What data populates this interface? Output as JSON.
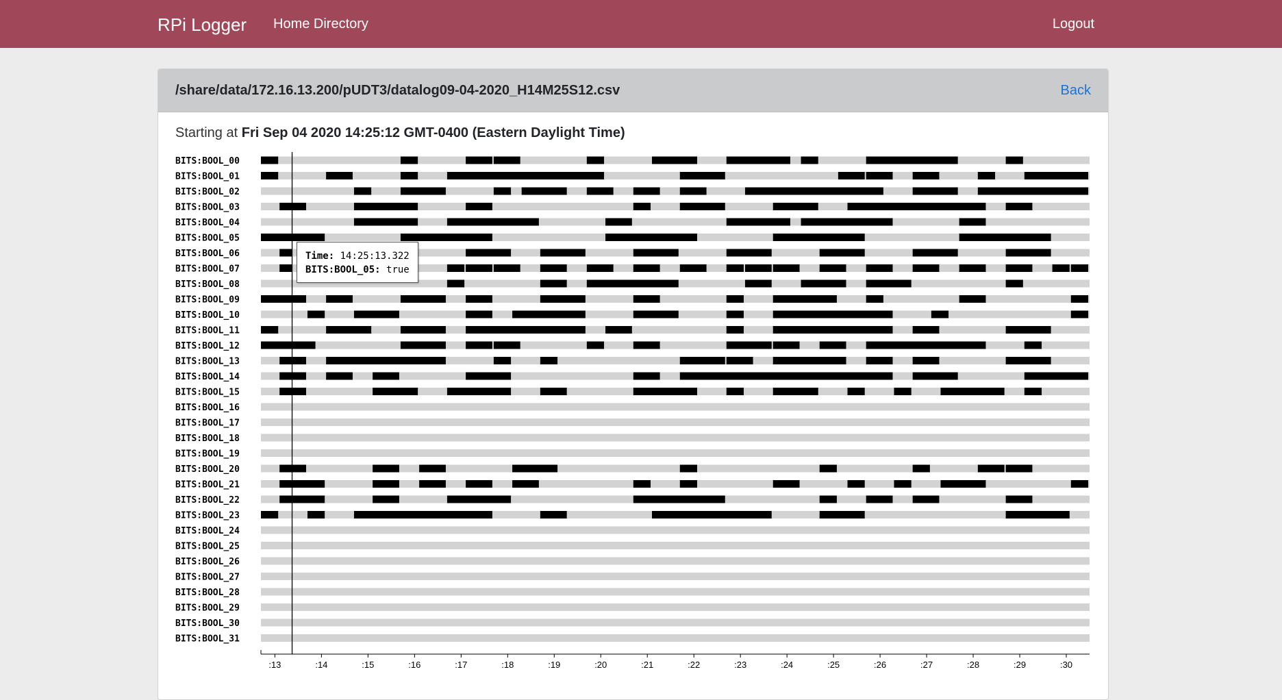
{
  "navbar": {
    "brand": "RPi Logger",
    "home_label": "Home Directory",
    "logout_label": "Logout",
    "color": "#a0485a"
  },
  "header": {
    "file_path": "/share/data/172.16.13.200/pUDT3/datalog09-04-2020_H14M25S12.csv",
    "back_label": "Back"
  },
  "start": {
    "prefix": "Starting at",
    "datetime": "Fri Sep 04 2020 14:25:12 GMT-0400 (Eastern Daylight Time)"
  },
  "tooltip": {
    "time_key": "Time:",
    "time_value": "14:25:13.322",
    "signal_key": "BITS:BOOL_05:",
    "signal_value": "true"
  },
  "chart_data": {
    "type": "timeline",
    "x_unit": "seconds after 14:25:00",
    "xlim": [
      12.7,
      30.5
    ],
    "cursor_x": 13.37,
    "tick_labels": [
      ":13",
      ":14",
      ":15",
      ":16",
      ":17",
      ":18",
      ":19",
      ":20",
      ":21",
      ":22",
      ":23",
      ":24",
      ":25",
      ":26",
      ":27",
      ":28",
      ":29",
      ":30"
    ],
    "tick_values": [
      13,
      14,
      15,
      16,
      17,
      18,
      19,
      20,
      21,
      22,
      23,
      24,
      25,
      26,
      27,
      28,
      29,
      30
    ],
    "colors": {
      "true": "#000000",
      "false": "#d3d3d3"
    },
    "series": [
      {
        "name": "BITS:BOOL_00",
        "true_intervals": [
          [
            12.7,
            13.1
          ],
          [
            15.7,
            16.1
          ],
          [
            17.1,
            17.7
          ],
          [
            17.7,
            18.3
          ],
          [
            19.7,
            20.1
          ],
          [
            21.1,
            22.1
          ],
          [
            22.7,
            24.1
          ],
          [
            24.3,
            24.7
          ],
          [
            25.7,
            27.7
          ],
          [
            28.7,
            29.1
          ]
        ]
      },
      {
        "name": "BITS:BOOL_01",
        "true_intervals": [
          [
            12.7,
            13.1
          ],
          [
            14.1,
            14.7
          ],
          [
            15.7,
            16.1
          ],
          [
            16.7,
            20.1
          ],
          [
            21.7,
            22.7
          ],
          [
            25.1,
            25.7
          ],
          [
            25.7,
            26.3
          ],
          [
            26.7,
            27.3
          ],
          [
            28.1,
            28.5
          ],
          [
            29.1,
            30.5
          ]
        ]
      },
      {
        "name": "BITS:BOOL_02",
        "true_intervals": [
          [
            14.7,
            15.1
          ],
          [
            15.7,
            16.7
          ],
          [
            17.7,
            18.1
          ],
          [
            18.3,
            19.3
          ],
          [
            19.7,
            20.3
          ],
          [
            20.7,
            21.3
          ],
          [
            21.7,
            22.3
          ],
          [
            23.1,
            26.1
          ],
          [
            26.7,
            27.7
          ],
          [
            28.1,
            30.5
          ]
        ]
      },
      {
        "name": "BITS:BOOL_03",
        "true_intervals": [
          [
            13.1,
            13.7
          ],
          [
            14.7,
            16.1
          ],
          [
            17.1,
            17.7
          ],
          [
            20.7,
            21.1
          ],
          [
            21.7,
            22.7
          ],
          [
            23.7,
            24.7
          ],
          [
            25.3,
            28.3
          ],
          [
            28.7,
            29.3
          ]
        ]
      },
      {
        "name": "BITS:BOOL_04",
        "true_intervals": [
          [
            14.7,
            16.1
          ],
          [
            16.7,
            18.7
          ],
          [
            20.1,
            20.7
          ],
          [
            22.7,
            24.1
          ],
          [
            24.3,
            26.3
          ],
          [
            27.7,
            28.3
          ]
        ]
      },
      {
        "name": "BITS:BOOL_05",
        "true_intervals": [
          [
            12.7,
            14.1
          ],
          [
            15.7,
            17.7
          ],
          [
            20.1,
            22.1
          ],
          [
            23.7,
            25.7
          ],
          [
            27.7,
            29.7
          ]
        ]
      },
      {
        "name": "BITS:BOOL_06",
        "true_intervals": [
          [
            13.1,
            13.4
          ],
          [
            17.1,
            18.1
          ],
          [
            18.7,
            19.7
          ],
          [
            20.7,
            21.7
          ],
          [
            22.7,
            23.7
          ],
          [
            24.7,
            25.7
          ],
          [
            26.7,
            27.7
          ],
          [
            28.7,
            29.7
          ]
        ]
      },
      {
        "name": "BITS:BOOL_07",
        "true_intervals": [
          [
            13.1,
            13.4
          ],
          [
            16.7,
            17.1
          ],
          [
            17.1,
            17.7
          ],
          [
            17.7,
            18.3
          ],
          [
            18.7,
            19.3
          ],
          [
            19.7,
            20.3
          ],
          [
            20.7,
            21.3
          ],
          [
            21.7,
            22.3
          ],
          [
            22.7,
            23.1
          ],
          [
            23.1,
            23.7
          ],
          [
            23.7,
            24.3
          ],
          [
            24.7,
            25.3
          ],
          [
            25.7,
            26.3
          ],
          [
            26.7,
            27.3
          ],
          [
            27.7,
            28.3
          ],
          [
            28.7,
            29.3
          ],
          [
            29.7,
            30.1
          ],
          [
            30.1,
            30.5
          ]
        ]
      },
      {
        "name": "BITS:BOOL_08",
        "true_intervals": [
          [
            16.7,
            17.1
          ],
          [
            18.7,
            19.3
          ],
          [
            19.7,
            21.7
          ],
          [
            23.1,
            23.7
          ],
          [
            24.3,
            25.3
          ],
          [
            25.7,
            26.7
          ],
          [
            28.7,
            29.1
          ]
        ]
      },
      {
        "name": "BITS:BOOL_09",
        "true_intervals": [
          [
            12.7,
            13.7
          ],
          [
            14.1,
            14.7
          ],
          [
            15.7,
            16.7
          ],
          [
            17.1,
            17.7
          ],
          [
            18.7,
            19.7
          ],
          [
            20.7,
            21.3
          ],
          [
            22.7,
            23.1
          ],
          [
            23.7,
            25.1
          ],
          [
            25.7,
            26.1
          ],
          [
            27.7,
            28.3
          ],
          [
            30.1,
            30.5
          ]
        ]
      },
      {
        "name": "BITS:BOOL_10",
        "true_intervals": [
          [
            13.7,
            14.1
          ],
          [
            14.7,
            15.7
          ],
          [
            17.1,
            17.7
          ],
          [
            18.1,
            19.7
          ],
          [
            20.7,
            21.7
          ],
          [
            22.7,
            23.1
          ],
          [
            23.7,
            26.3
          ],
          [
            27.1,
            27.5
          ],
          [
            30.1,
            30.5
          ]
        ]
      },
      {
        "name": "BITS:BOOL_11",
        "true_intervals": [
          [
            12.7,
            13.1
          ],
          [
            14.1,
            15.1
          ],
          [
            15.7,
            16.7
          ],
          [
            17.1,
            19.7
          ],
          [
            20.1,
            20.7
          ],
          [
            22.7,
            23.1
          ],
          [
            23.7,
            26.3
          ],
          [
            26.7,
            27.3
          ],
          [
            28.7,
            29.7
          ]
        ]
      },
      {
        "name": "BITS:BOOL_12",
        "true_intervals": [
          [
            12.7,
            13.9
          ],
          [
            15.7,
            16.7
          ],
          [
            17.1,
            17.7
          ],
          [
            17.7,
            18.3
          ],
          [
            19.7,
            20.1
          ],
          [
            20.7,
            21.3
          ],
          [
            22.7,
            23.7
          ],
          [
            23.7,
            24.3
          ],
          [
            24.7,
            25.3
          ],
          [
            25.7,
            28.3
          ],
          [
            29.1,
            29.5
          ]
        ]
      },
      {
        "name": "BITS:BOOL_13",
        "true_intervals": [
          [
            13.1,
            13.7
          ],
          [
            14.1,
            16.7
          ],
          [
            17.7,
            18.1
          ],
          [
            18.7,
            19.1
          ],
          [
            21.7,
            22.7
          ],
          [
            22.7,
            23.3
          ],
          [
            23.7,
            25.3
          ],
          [
            25.7,
            26.3
          ],
          [
            26.7,
            27.3
          ],
          [
            28.7,
            29.7
          ]
        ]
      },
      {
        "name": "BITS:BOOL_14",
        "true_intervals": [
          [
            13.1,
            13.7
          ],
          [
            14.1,
            14.7
          ],
          [
            15.1,
            15.7
          ],
          [
            17.1,
            18.1
          ],
          [
            20.7,
            21.3
          ],
          [
            21.7,
            26.3
          ],
          [
            26.7,
            27.7
          ],
          [
            29.1,
            30.5
          ]
        ]
      },
      {
        "name": "BITS:BOOL_15",
        "true_intervals": [
          [
            13.1,
            13.7
          ],
          [
            15.1,
            16.1
          ],
          [
            16.7,
            18.1
          ],
          [
            18.7,
            19.3
          ],
          [
            20.7,
            22.1
          ],
          [
            22.7,
            23.1
          ],
          [
            23.7,
            24.7
          ],
          [
            25.3,
            25.7
          ],
          [
            26.3,
            26.7
          ],
          [
            27.3,
            28.7
          ],
          [
            29.1,
            29.5
          ]
        ]
      },
      {
        "name": "BITS:BOOL_16",
        "true_intervals": []
      },
      {
        "name": "BITS:BOOL_17",
        "true_intervals": []
      },
      {
        "name": "BITS:BOOL_18",
        "true_intervals": []
      },
      {
        "name": "BITS:BOOL_19",
        "true_intervals": []
      },
      {
        "name": "BITS:BOOL_20",
        "true_intervals": [
          [
            13.1,
            13.7
          ],
          [
            15.1,
            15.7
          ],
          [
            16.1,
            16.7
          ],
          [
            18.1,
            19.1
          ],
          [
            21.7,
            22.1
          ],
          [
            24.7,
            25.1
          ],
          [
            26.7,
            27.1
          ],
          [
            28.1,
            28.7
          ],
          [
            28.7,
            29.3
          ]
        ]
      },
      {
        "name": "BITS:BOOL_21",
        "true_intervals": [
          [
            13.1,
            14.1
          ],
          [
            15.1,
            15.7
          ],
          [
            16.1,
            16.7
          ],
          [
            17.1,
            17.7
          ],
          [
            18.1,
            18.7
          ],
          [
            20.7,
            21.1
          ],
          [
            21.7,
            22.1
          ],
          [
            23.7,
            24.3
          ],
          [
            25.3,
            25.7
          ],
          [
            26.3,
            26.7
          ],
          [
            27.3,
            28.3
          ],
          [
            30.1,
            30.5
          ]
        ]
      },
      {
        "name": "BITS:BOOL_22",
        "true_intervals": [
          [
            13.1,
            14.1
          ],
          [
            15.1,
            15.7
          ],
          [
            16.7,
            18.1
          ],
          [
            20.7,
            22.7
          ],
          [
            24.7,
            25.1
          ],
          [
            25.7,
            26.3
          ],
          [
            26.7,
            27.3
          ],
          [
            28.7,
            29.3
          ]
        ]
      },
      {
        "name": "BITS:BOOL_23",
        "true_intervals": [
          [
            12.7,
            13.1
          ],
          [
            13.7,
            14.1
          ],
          [
            14.7,
            17.7
          ],
          [
            18.7,
            19.3
          ],
          [
            21.1,
            23.7
          ],
          [
            24.7,
            25.7
          ],
          [
            28.7,
            30.1
          ]
        ]
      },
      {
        "name": "BITS:BOOL_24",
        "true_intervals": []
      },
      {
        "name": "BITS:BOOL_25",
        "true_intervals": []
      },
      {
        "name": "BITS:BOOL_26",
        "true_intervals": []
      },
      {
        "name": "BITS:BOOL_27",
        "true_intervals": []
      },
      {
        "name": "BITS:BOOL_28",
        "true_intervals": []
      },
      {
        "name": "BITS:BOOL_29",
        "true_intervals": []
      },
      {
        "name": "BITS:BOOL_30",
        "true_intervals": []
      },
      {
        "name": "BITS:BOOL_31",
        "true_intervals": []
      }
    ]
  }
}
